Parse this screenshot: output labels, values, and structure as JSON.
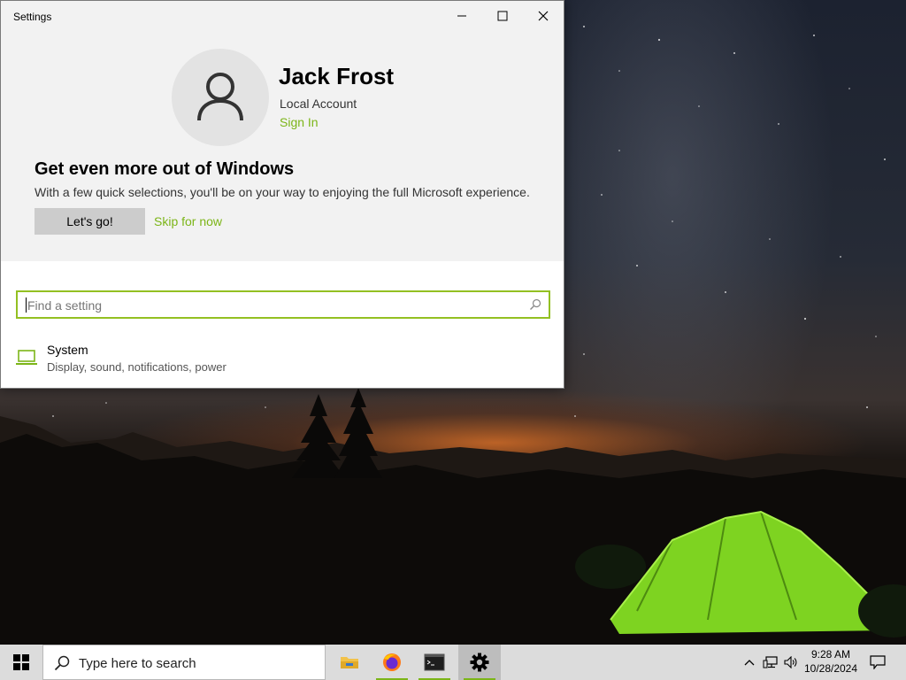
{
  "window": {
    "title": "Settings",
    "controls": [
      "minimize",
      "maximize",
      "close"
    ]
  },
  "account": {
    "name": "Jack Frost",
    "type": "Local Account",
    "sign_in": "Sign In"
  },
  "promo": {
    "heading": "Get even more out of Windows",
    "text": "With a few quick selections, you'll be on your way to enjoying the full Microsoft experience.",
    "primary_button": "Let's go!",
    "secondary_link": "Skip for now"
  },
  "search": {
    "placeholder": "Find a setting"
  },
  "settings_items": [
    {
      "title": "System",
      "description": "Display, sound, notifications, power",
      "icon": "laptop-icon"
    }
  ],
  "taskbar": {
    "search_placeholder": "Type here to search",
    "apps": [
      "file-explorer-icon",
      "firefox-icon",
      "terminal-icon",
      "settings-gear-icon"
    ],
    "clock": {
      "time": "9:28 AM",
      "date": "10/28/2024"
    }
  },
  "colors": {
    "accent": "#7cb518",
    "search_border": "#93c022",
    "hero_bg": "#f2f2f2",
    "taskbar_bg": "#dcdcdc"
  }
}
